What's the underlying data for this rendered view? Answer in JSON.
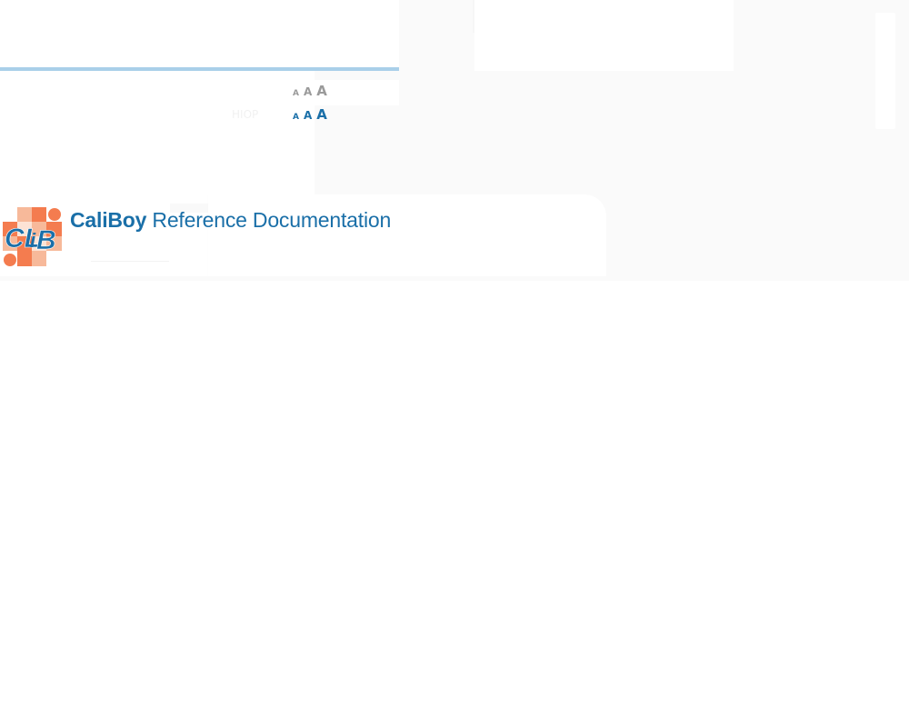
{
  "header": {
    "title_brand": "CaliBoy",
    "title_rest": " Reference Documentation",
    "faded_label": "HIOP"
  },
  "font_size_controls": {
    "inactive": {
      "small": "A",
      "medium": "A",
      "large": "A"
    },
    "active": {
      "small": "A",
      "medium": "A",
      "large": "A"
    }
  },
  "logo": {
    "lettering": "CLiB",
    "colors": {
      "blue": "#1a6fa8",
      "orange": "#f47c4f",
      "peach": "#f7b99a"
    }
  },
  "colors": {
    "accent": "#1a6fa8",
    "rule": "#a9cfe9",
    "inactive_text": "#9a9a9a"
  }
}
